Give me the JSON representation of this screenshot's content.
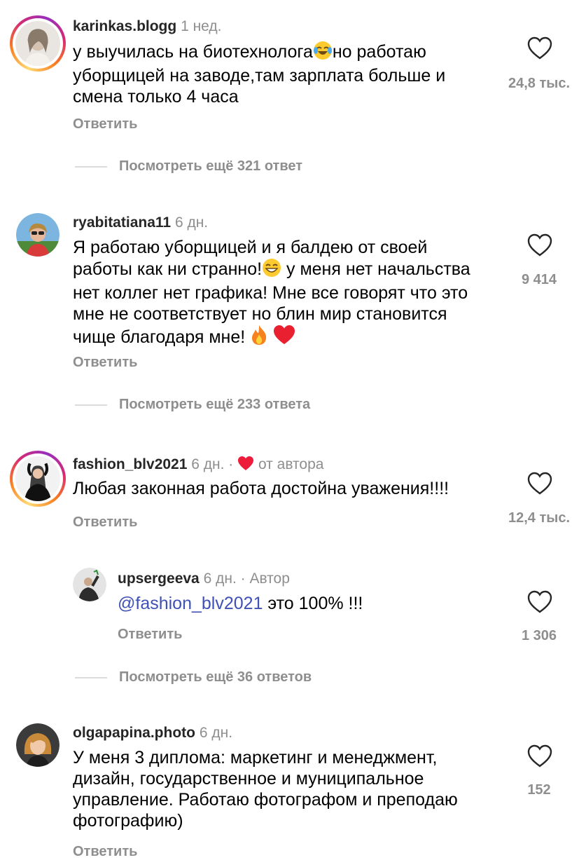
{
  "comments": [
    {
      "username": "karinkas.blogg",
      "time": "1 нед.",
      "text_before": "у выучилась на биотехнолога",
      "text_after": "но работаю уборщицей на заводе,там зарплата больше и смена только 4 часа",
      "likes": "24,8 тыс.",
      "reply": "Ответить",
      "more_replies": "Посмотреть ещё 321 ответ"
    },
    {
      "username": "ryabitatiana11",
      "time": "6 дн.",
      "text_before": "Я работаю уборщицей и я балдею от своей работы как ни странно!",
      "text_after": " у меня нет начальства нет коллег нет графика! Мне все говорят что это мне не соответствует но блин мир становится чище благодаря мне!",
      "likes": "9 414",
      "reply": "Ответить",
      "more_replies": "Посмотреть ещё 233 ответа"
    },
    {
      "username": "fashion_blv2021",
      "time": "6 дн.",
      "author_badge": "от автора",
      "text": "Любая законная работа достойна уважения!!!!",
      "likes": "12,4 тыс.",
      "reply": "Ответить",
      "more_replies": "Посмотреть ещё 36 ответов"
    },
    {
      "username": "upsergeeva",
      "time": "6 дн.",
      "author_label": "Автор",
      "mention": "@fashion_blv2021",
      "text": " это 100% !!!",
      "likes": "1 306",
      "reply": "Ответить"
    },
    {
      "username": "olgapapina.photo",
      "time": "6 дн.",
      "text": "У меня 3 диплома: маркетинг и менеджмент, дизайн, государственное и муниципальное управление. Работаю фотографом и преподаю фотографию)",
      "likes": "152",
      "reply": "Ответить"
    }
  ],
  "separator": " · ",
  "icons": {
    "like": "heart-outline-icon",
    "author_like": "heart-filled-icon",
    "emoji_1": "face-with-tears-of-joy",
    "emoji_2": "grinning-face",
    "emoji_3": "fire",
    "emoji_4": "red-heart"
  },
  "colors": {
    "username": "#262626",
    "meta": "#8e8e8e",
    "mention": "#3f51b5",
    "liked_heart": "#ed1c3a"
  }
}
